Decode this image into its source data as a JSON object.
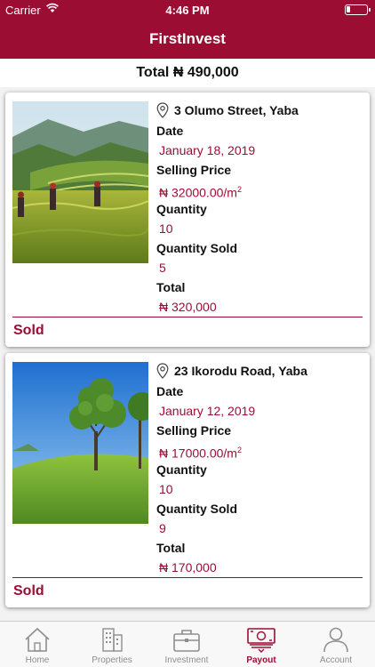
{
  "status_bar": {
    "carrier": "Carrier",
    "time": "4:46 PM"
  },
  "nav": {
    "title": "FirstInvest"
  },
  "summary": {
    "total_text": "Total ₦ 490,000"
  },
  "labels": {
    "date": "Date",
    "selling_price": "Selling Price",
    "quantity": "Quantity",
    "quantity_sold": "Quantity Sold",
    "total": "Total"
  },
  "cards": [
    {
      "address": "3 Olumo Street, Yaba",
      "date": "January 18, 2019",
      "price": "₦ 32000.00/m",
      "unit_sup": "2",
      "quantity": "10",
      "quantity_sold": "5",
      "total": "₦ 320,000",
      "status": "Sold",
      "photo": "rice-terrace-field-photo"
    },
    {
      "address": "23 Ikorodu Road, Yaba",
      "date": "January 12, 2019",
      "price": "₦ 17000.00/m",
      "unit_sup": "2",
      "quantity": "10",
      "quantity_sold": "9",
      "total": "₦ 170,000",
      "status": "Sold",
      "photo": "tree-on-green-hill-photo"
    }
  ],
  "tabs": [
    {
      "label": "Home",
      "icon": "home-icon",
      "active": false
    },
    {
      "label": "Properties",
      "icon": "buildings-icon",
      "active": false
    },
    {
      "label": "Investment",
      "icon": "briefcase-icon",
      "active": false
    },
    {
      "label": "Payout",
      "icon": "money-icon",
      "active": true
    },
    {
      "label": "Account",
      "icon": "user-icon",
      "active": false
    }
  ],
  "colors": {
    "brand": "#9c0d33",
    "inactive_tab": "#8e8e8e"
  }
}
